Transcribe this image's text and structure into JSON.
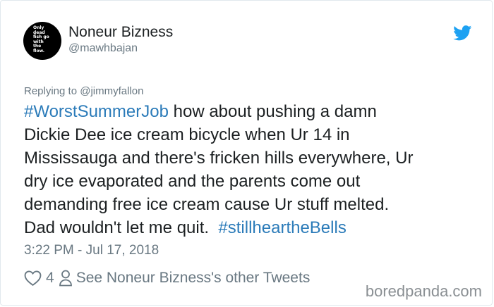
{
  "tweet": {
    "avatar_text": [
      "Only",
      "dead",
      "fish go",
      "with",
      "the",
      "flow."
    ],
    "display_name": "Noneur Bizness",
    "handle": "@mawhbajan",
    "replying_to": "Replying to @jimmyfallon",
    "body_lines": [
      {
        "hashtag": "#WorstSummerJob",
        "text": " how about pushing a damn"
      },
      {
        "text": "Dickie Dee ice cream bicycle when Ur 14 in"
      },
      {
        "text": "Mississauga and there's fricken hills everywhere, Ur"
      },
      {
        "text": "dry ice evaporated and the parents come out"
      },
      {
        "text": "demanding free ice cream cause Ur stuff melted."
      },
      {
        "text": "Dad wouldn't let me quit.  ",
        "hashtag": "#stillheartheBells"
      }
    ],
    "timestamp": "3:22 PM - Jul 17, 2018",
    "like_count": "4",
    "other_tweets_link": "See Noneur Bizness's other Tweets"
  },
  "icons": {
    "brand": "twitter-bird-icon",
    "like": "heart-icon",
    "profile": "person-icon"
  },
  "colors": {
    "link": "#2b7bb9",
    "twitter_blue": "#1da1f2",
    "muted": "#697882",
    "text": "#1c2022"
  },
  "watermark": "boredpanda.com"
}
